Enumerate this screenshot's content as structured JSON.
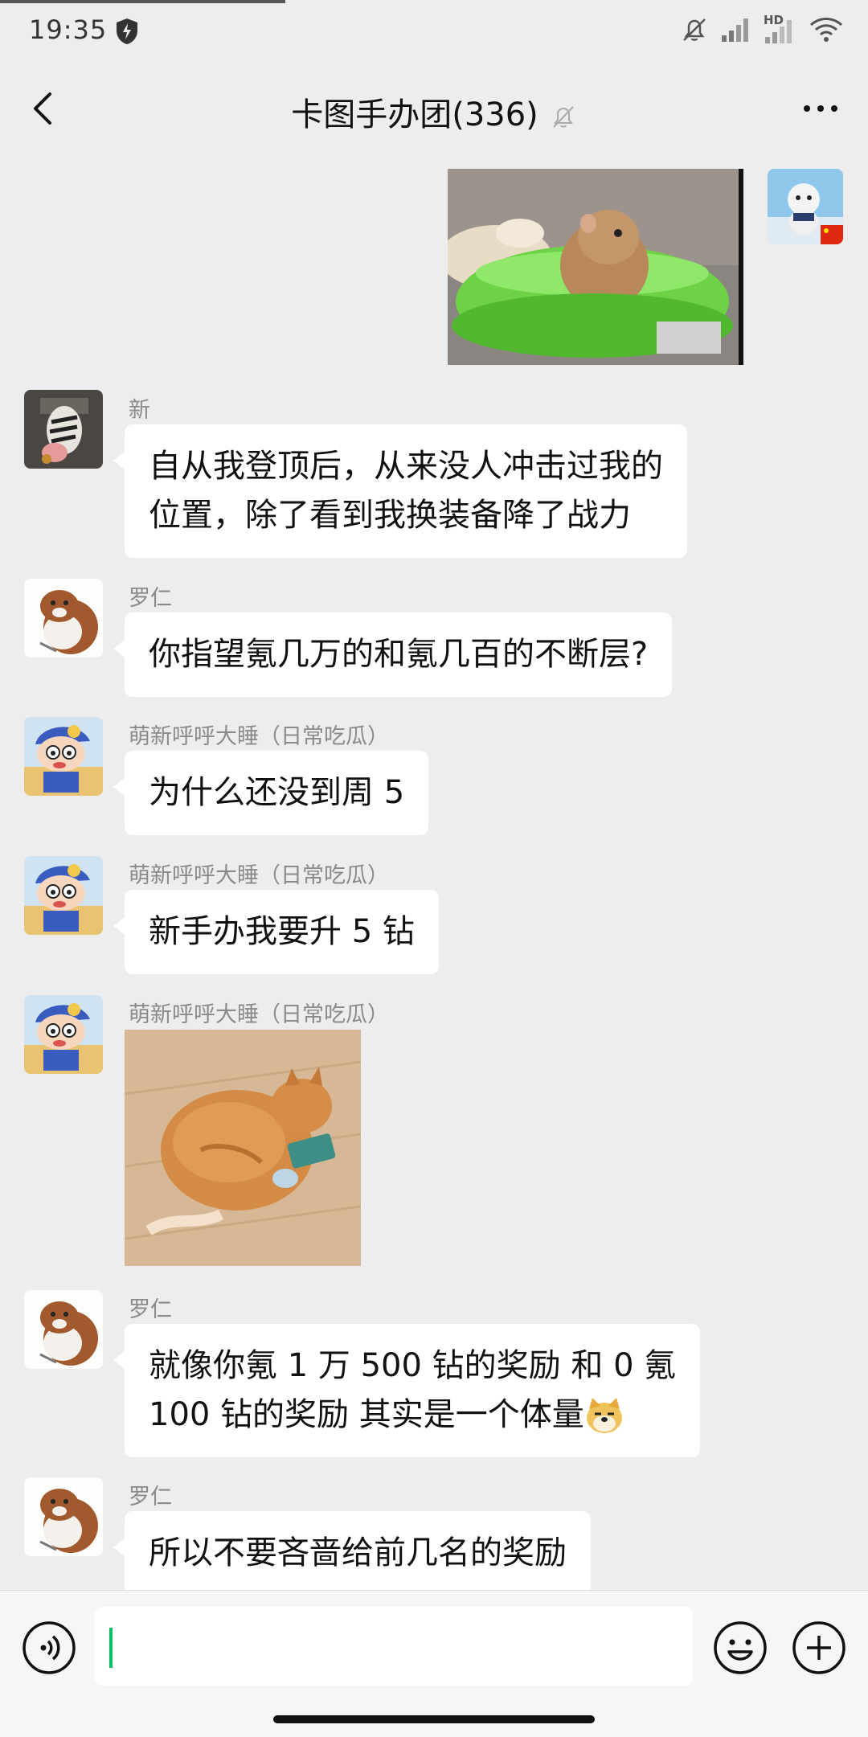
{
  "status_bar": {
    "time": "19:35",
    "network_label": "HD",
    "icons": [
      "shield-icon",
      "bell-off-icon",
      "signal-icon",
      "signal-hd-icon",
      "wifi-icon"
    ]
  },
  "header": {
    "title": "卡图手办团(336)",
    "icons": [
      "back-icon",
      "mute-icon",
      "more-icon"
    ]
  },
  "messages": [
    {
      "sender": "",
      "type": "image",
      "outgoing": true,
      "image": "hamster-in-green-bowl"
    },
    {
      "sender": "新",
      "type": "text",
      "lines": [
        "自从我登顶后，从来没人冲击过我的",
        "位置，除了看到我换装备降了战力"
      ]
    },
    {
      "sender": "罗仁",
      "type": "text",
      "lines": [
        "你指望氪几万的和氪几百的不断层?"
      ]
    },
    {
      "sender": "萌新呼呼大睡（日常吃瓜）",
      "type": "text",
      "lines": [
        "为什么还没到周 5"
      ]
    },
    {
      "sender": "萌新呼呼大睡（日常吃瓜）",
      "type": "text",
      "lines": [
        "新手办我要升 5 钻"
      ]
    },
    {
      "sender": "萌新呼呼大睡（日常吃瓜）",
      "type": "image",
      "image": "orange-cat-holding-snack"
    },
    {
      "sender": "罗仁",
      "type": "text",
      "lines": [
        "就像你氪 1 万 500 钻的奖励 和 0 氪",
        "100 钻的奖励 其实是一个体量"
      ],
      "trailing_emoji": "doge-emoji"
    },
    {
      "sender": "罗仁",
      "type": "text",
      "lines": [
        "所以不要吝啬给前几名的奖励"
      ]
    }
  ],
  "input_bar": {
    "value": "",
    "icons": [
      "voice-icon",
      "emoji-icon",
      "plus-icon"
    ]
  },
  "colors": {
    "background": "#ededed",
    "bubble": "#ffffff",
    "accent": "#07c160",
    "sender_text": "#8a8a8a"
  }
}
